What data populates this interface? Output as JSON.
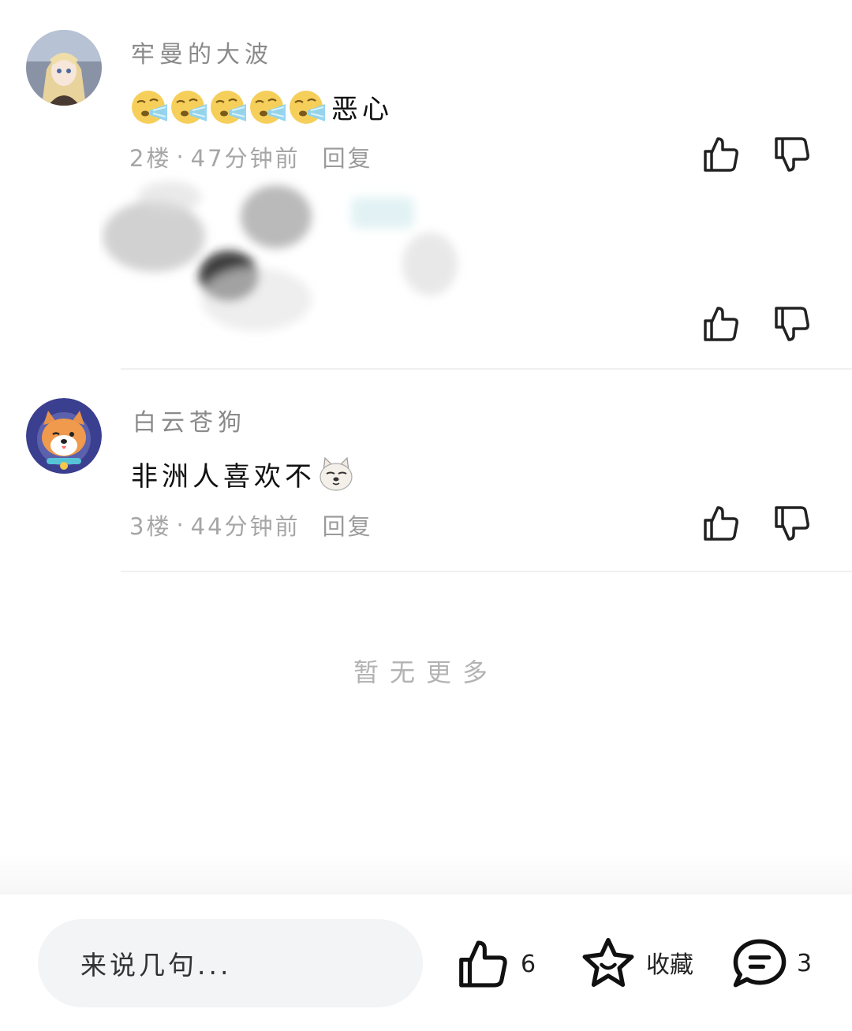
{
  "comments": [
    {
      "username": "牢曼的大波",
      "text": "恶心",
      "emoji_count": 5,
      "emoji": "yawning-face",
      "floor": "2楼",
      "time": "47分钟前",
      "reply_label": "回复"
    },
    {
      "username": "白云苍狗",
      "text": "非洲人喜欢不",
      "emoji": "dog-face",
      "floor": "3楼",
      "time": "44分钟前",
      "reply_label": "回复"
    }
  ],
  "dot": "·",
  "footer_text": "暂无更多",
  "bottom_bar": {
    "input_placeholder": "来说几句...",
    "like_count": "6",
    "favorite_label": "收藏",
    "comment_count": "3"
  },
  "colors": {
    "meta_text": "#a6a6a6",
    "username_text": "#8a8a8a",
    "input_bg": "#f3f4f6"
  }
}
